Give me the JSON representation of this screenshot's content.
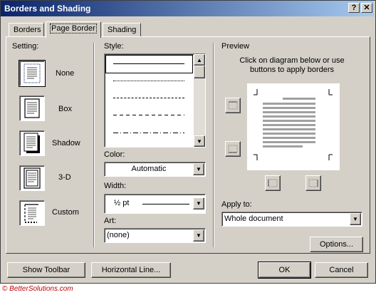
{
  "dialog": {
    "title": "Borders and Shading",
    "help_glyph": "?",
    "close_glyph": "✕"
  },
  "tabs": [
    {
      "label": "Borders"
    },
    {
      "label": "Page Border"
    },
    {
      "label": "Shading"
    }
  ],
  "setting": {
    "heading": "Setting:",
    "options": [
      "None",
      "Box",
      "Shadow",
      "3-D",
      "Custom"
    ]
  },
  "style": {
    "heading": "Style:",
    "line_styles": [
      "solid",
      "dotted",
      "dashed-fine",
      "dashed",
      "dash-dot"
    ]
  },
  "color": {
    "heading": "Color:",
    "value": "Automatic"
  },
  "width": {
    "heading": "Width:",
    "value": "½ pt"
  },
  "art": {
    "heading": "Art:",
    "value": "(none)"
  },
  "preview": {
    "heading": "Preview",
    "hint_line1": "Click on diagram below or use",
    "hint_line2": "buttons to apply borders"
  },
  "apply_to": {
    "heading": "Apply to:",
    "value": "Whole document"
  },
  "buttons": {
    "options": "Options...",
    "show_toolbar": "Show Toolbar",
    "horizontal_line": "Horizontal Line...",
    "ok": "OK",
    "cancel": "Cancel"
  },
  "footer": {
    "copyright": "© BetterSolutions.com"
  },
  "colors": {
    "title_start": "#0a246a",
    "title_end": "#a6caf0",
    "dialog_bg": "#d4d0c8",
    "copyright": "#c00000"
  }
}
